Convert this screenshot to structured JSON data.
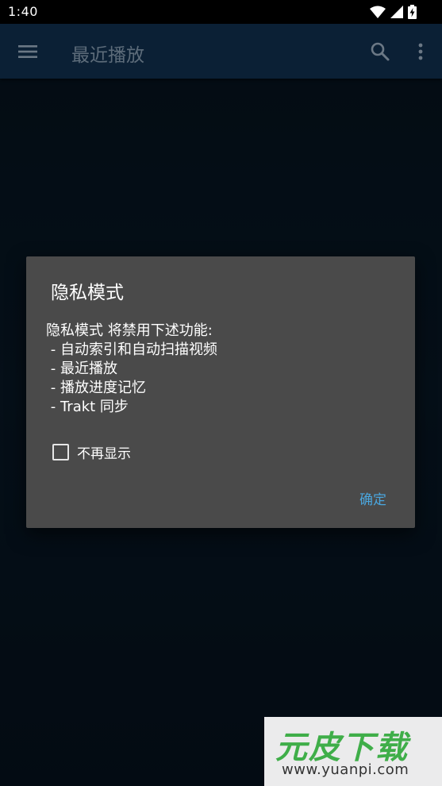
{
  "status_bar": {
    "time": "1:40",
    "icons": [
      "wifi-icon",
      "signal-icon",
      "battery-charging-icon"
    ]
  },
  "toolbar": {
    "title": "最近播放",
    "icons": [
      "menu-icon",
      "search-icon",
      "more-vert-icon"
    ]
  },
  "dialog": {
    "title": "隐私模式",
    "message_lines": [
      "隐私模式 将禁用下述功能:",
      " - 自动索引和自动扫描视频",
      " - 最近播放",
      " - 播放进度记忆",
      " - Trakt 同步"
    ],
    "checkbox_label": "不再显示",
    "checkbox_checked": false,
    "confirm_label": "确定"
  },
  "watermark": {
    "logo": "元皮下载",
    "url": "www.yuanpi.com"
  },
  "colors": {
    "accent": "#4aa6de",
    "dialog_bg": "#4a4a4a",
    "toolbar_bg": "#0b2035",
    "watermark_green": "#3fae49"
  }
}
